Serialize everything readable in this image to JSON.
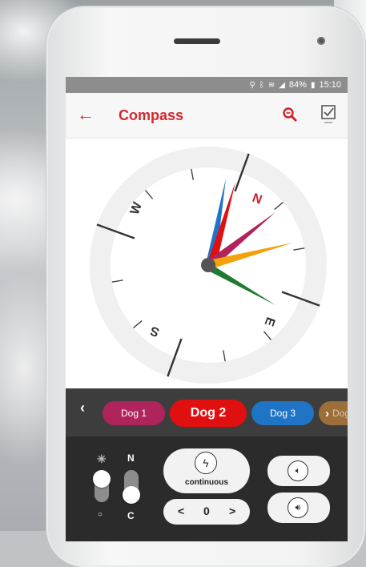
{
  "status_bar": {
    "battery": "84%",
    "time": "15:10"
  },
  "app_bar": {
    "title": "Compass"
  },
  "compass": {
    "labels": {
      "north": "N",
      "east": "E",
      "south": "S",
      "west": "W"
    }
  },
  "dog_bar": {
    "prev_glyph": "‹",
    "next_glyph": "›",
    "dogs": [
      {
        "label": "Dog 1",
        "color": "#b0245c",
        "selected": false
      },
      {
        "label": "Dog 2",
        "color": "#e01010",
        "selected": true
      },
      {
        "label": "Dog 3",
        "color": "#1f74c6",
        "selected": false
      },
      {
        "label": "Dog",
        "color": "#9c6f3a",
        "selected": false
      }
    ]
  },
  "controls": {
    "light_label_top": "✳",
    "light_label_bottom": "○",
    "mode_label_top": "N",
    "mode_label_bottom": "C",
    "stimulation_mode": "continuous",
    "level_value": "0",
    "level_left": "<",
    "level_right": ">"
  },
  "colors": {
    "accent": "#d0232c",
    "dog1": "#b0245c",
    "dog2": "#e01010",
    "dog3": "#1f74c6",
    "dog4": "#9c6f3a"
  }
}
